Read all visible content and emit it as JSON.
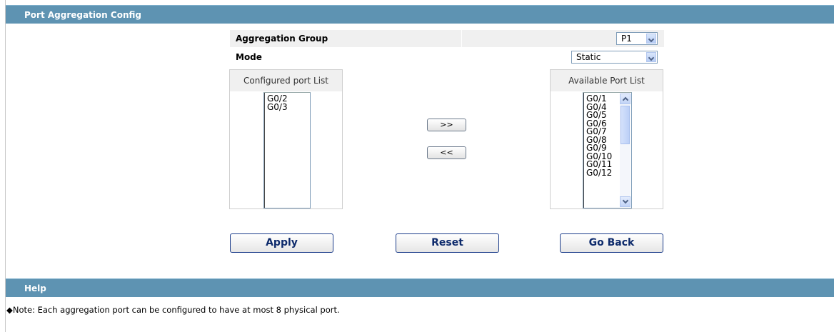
{
  "config_section": {
    "title": "Port Aggregation Config"
  },
  "form": {
    "group_label": "Aggregation Group",
    "group_value": "P1",
    "mode_label": "Mode",
    "mode_value": "Static"
  },
  "configured": {
    "header": "Configured port List",
    "items": [
      "G0/2",
      "G0/3"
    ]
  },
  "available": {
    "header": "Available Port List",
    "items": [
      "G0/1",
      "G0/4",
      "G0/5",
      "G0/6",
      "G0/7",
      "G0/8",
      "G0/9",
      "G0/10",
      "G0/11",
      "G0/12"
    ]
  },
  "move_buttons": {
    "add_label": ">>",
    "remove_label": "<<"
  },
  "actions": {
    "apply": "Apply",
    "reset": "Reset",
    "go_back": "Go Back"
  },
  "help_section": {
    "title": "Help",
    "note": "◆Note: Each aggregation port can be configured to have at most 8 physical port."
  },
  "colors": {
    "section_bar": "#5e93b2",
    "button_text": "#0d2a6b"
  }
}
